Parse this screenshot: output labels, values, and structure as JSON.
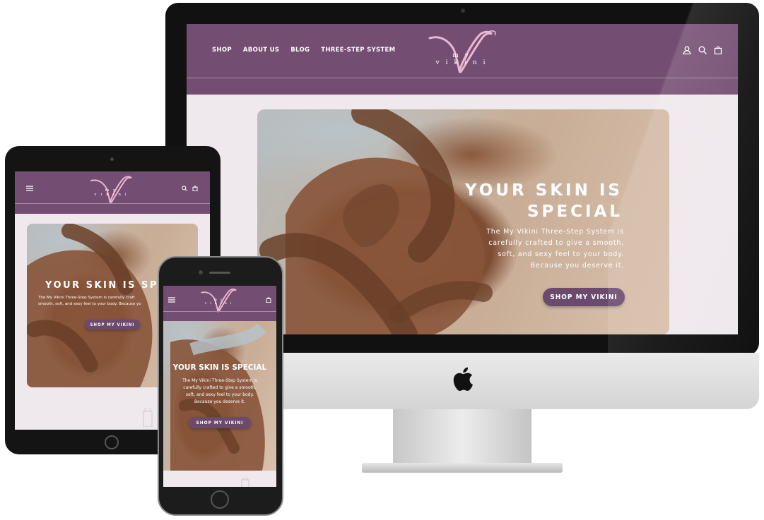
{
  "brand": {
    "logo_text": "my vikini",
    "colors": {
      "nav": "#744d72",
      "button": "#6b4a6e",
      "page_bg": "#efe8ec",
      "logo_pink": "#e9b8d2"
    }
  },
  "desktop": {
    "nav": {
      "items": [
        {
          "label": "SHOP"
        },
        {
          "label": "ABOUT US"
        },
        {
          "label": "BLOG"
        },
        {
          "label": "THREE-STEP SYSTEM"
        }
      ],
      "icons": [
        "account-icon",
        "search-icon",
        "cart-icon"
      ]
    },
    "hero": {
      "title_line1": "YOUR SKIN IS",
      "title_line2": "SPECIAL",
      "body_line1": "The My Vikini Three-Step System is",
      "body_line2": "carefully crafted to give a smooth,",
      "body_line3": "soft, and sexy feel to your body.",
      "body_line4": "Because you deserve it.",
      "cta": "SHOP MY VIKINI"
    }
  },
  "tablet": {
    "hero": {
      "title": "YOUR SKIN IS SPECI",
      "body_line1": "The My Vikini Three-Step System is carefully craft",
      "body_line2": "smooth, soft, and sexy feel to your body. Because yo",
      "cta": "SHOP MY VIKINI"
    }
  },
  "phone": {
    "hero": {
      "title": "YOUR SKIN IS SPECIAL",
      "body_line1": "The My Vikini Three-Step System is",
      "body_line2": "carefully crafted to give a smooth,",
      "body_line3": "soft, and sexy feel to your body.",
      "body_line4": "Because you deserve it.",
      "cta": "SHOP MY VIKINI"
    }
  }
}
